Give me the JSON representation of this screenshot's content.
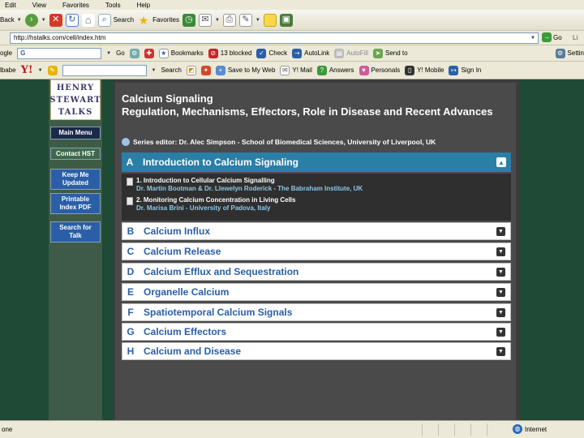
{
  "menu": [
    "Edit",
    "View",
    "Favorites",
    "Tools",
    "Help"
  ],
  "toolbar": {
    "back": "Back",
    "search": "Search",
    "favorites": "Favorites"
  },
  "address": {
    "url": "http://hstalks.com/cell/index.htm",
    "go": "Go",
    "links": "Li"
  },
  "google": {
    "label": "ogle",
    "input_value": "G",
    "go": "Go",
    "bookmarks": "Bookmarks",
    "blocked": "13 blocked",
    "check": "Check",
    "autolink": "AutoLink",
    "autofill": "AutoFill",
    "sendto": "Send to",
    "settings": "Settin"
  },
  "yahoo": {
    "label": "lbabe",
    "search": "Search",
    "save": "Save to My Web",
    "mail": "Y! Mail",
    "answers": "Answers",
    "personals": "Personals",
    "mobile": "Y! Mobile",
    "signin": "Sign In"
  },
  "nav": {
    "logo_lines": [
      "HENRY",
      "STEWART",
      "TALKS"
    ],
    "main_menu": "Main Menu",
    "contact": "Contact HST",
    "keep_line1": "Keep Me",
    "keep_line2": "Updated",
    "print_line1": "Printable",
    "print_line2": "Index PDF",
    "search_line1": "Search for",
    "search_line2": "Talk"
  },
  "content": {
    "title": "Calcium Signaling",
    "subtitle": "Regulation, Mechanisms, Effectors, Role in Disease and Recent Advances",
    "editor": "Series editor: Dr. Alec Simpson - School of Biomedical Sciences, University of Liverpool, UK",
    "open_section": {
      "letter": "A",
      "name": "Introduction to Calcium Signaling"
    },
    "talks": [
      {
        "title": "1. Introduction to Cellular Calcium Signalling",
        "speaker": "Dr. Martin Bootman & Dr. Llewelyn Roderick - The Babraham Institute, UK"
      },
      {
        "title": "2. Monitoring Calcium Concentration in Living Cells",
        "speaker": "Dr. Marisa Brini - University of Padova, Italy"
      }
    ],
    "sections": [
      {
        "letter": "B",
        "name": "Calcium Influx"
      },
      {
        "letter": "C",
        "name": "Calcium Release"
      },
      {
        "letter": "D",
        "name": "Calcium Efflux and Sequestration"
      },
      {
        "letter": "E",
        "name": "Organelle Calcium"
      },
      {
        "letter": "F",
        "name": "Spatiotemporal Calcium Signals"
      },
      {
        "letter": "G",
        "name": "Calcium Effectors"
      },
      {
        "letter": "H",
        "name": "Calcium and Disease"
      }
    ]
  },
  "status": {
    "left": "one",
    "zone": "Internet"
  },
  "colors": {
    "page_bg": "#1f4a35",
    "section_open": "#2b7fa6",
    "section_text": "#2a5fa8",
    "nav_blue": "#2a5fa8"
  }
}
